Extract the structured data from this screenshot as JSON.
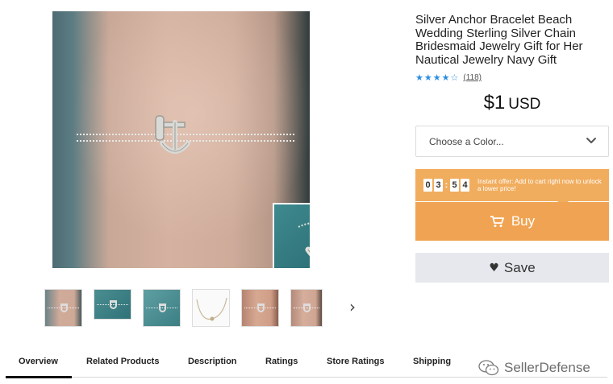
{
  "product": {
    "title": "Silver Anchor Bracelet Beach Wedding Sterling Silver Chain Bridesmaid Jewelry Gift for Her Nautical Jewelry Navy Gift",
    "rating": 4,
    "rating_max": 5,
    "review_count": "(118)",
    "price": "$1",
    "currency": "USD"
  },
  "color_select": {
    "placeholder": "Choose a Color..."
  },
  "offer": {
    "timer_digits": [
      "0",
      "3",
      "5",
      "4"
    ],
    "text": "Instant offer: Add to cart right now to unlock a lower price!"
  },
  "buttons": {
    "buy_label": "Buy",
    "save_label": "Save"
  },
  "gallery": {
    "thumbnail_count": 6,
    "next_arrow": "›"
  },
  "tabs": [
    {
      "label": "Overview",
      "active": true
    },
    {
      "label": "Related Products",
      "active": false
    },
    {
      "label": "Description",
      "active": false
    },
    {
      "label": "Ratings",
      "active": false
    },
    {
      "label": "Store Ratings",
      "active": false
    },
    {
      "label": "Shipping",
      "active": false
    }
  ],
  "watermark": {
    "text": "SellerDefense"
  },
  "colors": {
    "accent_orange": "#f0a453",
    "offer_orange": "#f1ad5e",
    "star_blue": "#2b8de0",
    "save_bg": "#e6e8ed"
  },
  "icons": {
    "cart": "cart-icon",
    "heart": "heart-icon",
    "chevron": "chevron-down-icon",
    "next": "chevron-right-icon",
    "watermark": "wechat-icon"
  }
}
